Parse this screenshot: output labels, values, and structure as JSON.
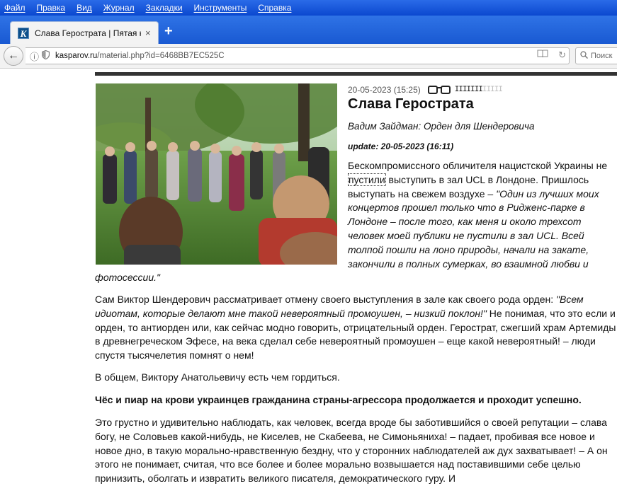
{
  "menu": {
    "items": [
      "Файл",
      "Правка",
      "Вид",
      "Журнал",
      "Закладки",
      "Инструменты",
      "Справка"
    ]
  },
  "tab": {
    "favicon_letter": "K",
    "title": "Слава Герострата | Пятая к...",
    "close": "×",
    "new_tab": "+"
  },
  "nav": {
    "back": "←",
    "url_domain": "kasparov.ru",
    "url_path": "/material.php?id=6468BB7EC525C",
    "search_placeholder": "Поиск"
  },
  "article": {
    "date": "20-05-2023 (15:25)",
    "rating_dark": "IIIIIII",
    "rating_light": "IIIII",
    "title": "Слава Герострата",
    "subtitle": "Вадим Зайдман: Орден для Шендеровича",
    "update": "update: 20-05-2023 (16:11)",
    "lead_part1": "Бескомпромиссного обличителя нацистской Украины не ",
    "lead_link": "пустили",
    "lead_part2": " выступить в зал UCL в Лондоне. Пришлось выступать на свежем воздухе – ",
    "lead_quote": "\"Один из лучших моих концертов прошел только что в Ридженс-парке в Лондоне – после того, как меня и около трехсот человек моей публики не пустили в зал UCL. Всей толпой пошли на лоно природы, начали на закате, закончили в полных сумерках, во взаимной любви и фотосессии.\"",
    "p1_part1": "Сам Виктор Шендерович рассматривает отмену своего выступления в зале как своего рода орден: ",
    "p1_quote": "\"Всем идиотам, которые делают мне такой невероятный промоушен, – низкий поклон!\"",
    "p1_part2": " Не понимая, что это если и орден, то антиорден или, как сейчас модно говорить, отрицательный орден. Герострат, сжегший храм Артемиды в древнегреческом Эфесе, на века сделал себе невероятный промоушен – еще какой невероятный! – люди спустя тысячелетия помнят о нем!",
    "p2": "В общем, Виктору Анатольевичу есть чем гордиться.",
    "p3": "Чёс и пиар на крови украинцев гражданина страны-агрессора продолжается и проходит успешно.",
    "p4": "Это грустно и удивительно наблюдать, как человек, всегда вроде бы заботившийся о своей репутации – слава богу, не Соловьев какой-нибудь, не Киселев, не Скабеева, не Симоньяниха! – падает, пробивая все новое и новое дно, в такую морально-нравственную бездну, что у сторонних наблюдателей аж дух захватывает! – А он этого не понимает, считая, что все более и более морально возвышается над поставившими себе целью принизить, оболгать и извратить великого писателя, демократического гуру. И"
  },
  "colors": {
    "menubar": "#0b48cf",
    "tabstrip": "#1959d2",
    "text": "#111111"
  }
}
